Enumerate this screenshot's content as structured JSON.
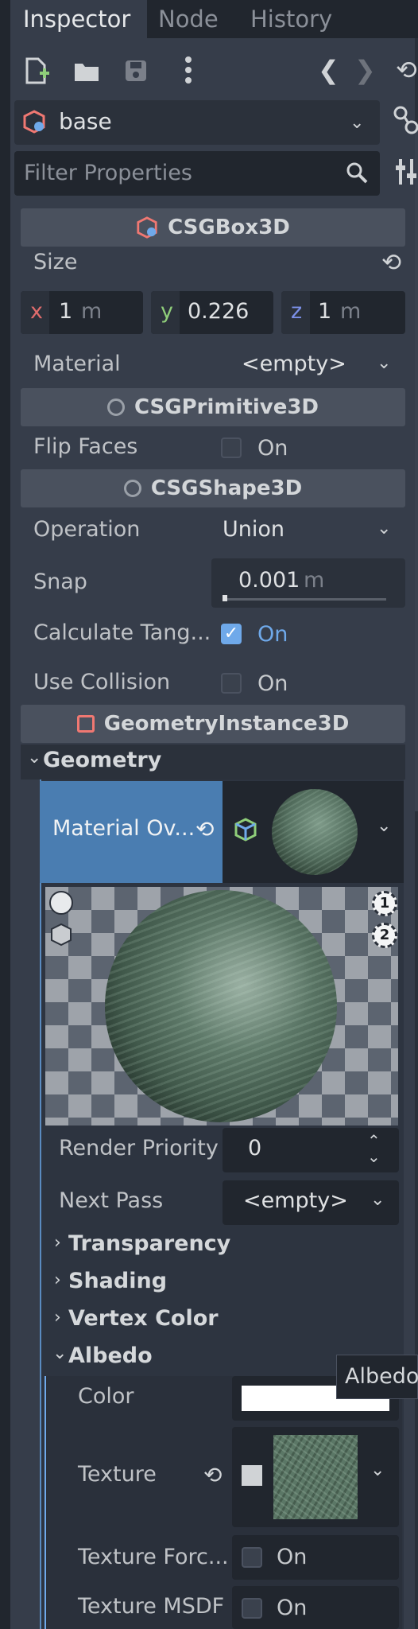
{
  "tabs": [
    {
      "label": "Inspector",
      "active": true
    },
    {
      "label": "Node",
      "active": false
    },
    {
      "label": "History",
      "active": false
    }
  ],
  "toolbar": {
    "icons": [
      "new-resource-icon",
      "open-folder-icon",
      "save-icon",
      "more-vert-icon",
      "back-arrow-icon",
      "forward-arrow-icon",
      "history-icon"
    ]
  },
  "object_selector": {
    "name": "base"
  },
  "filter": {
    "placeholder": "Filter Properties"
  },
  "sections": {
    "csgbox": "CSGBox3D",
    "csgprimitive": "CSGPrimitive3D",
    "csgshape": "CSGShape3D",
    "geometry_instance": "GeometryInstance3D"
  },
  "size": {
    "label": "Size",
    "x_axis": "x",
    "x_value": "1",
    "x_unit": "m",
    "y_axis": "y",
    "y_value": "0.226",
    "z_axis": "z",
    "z_value": "1",
    "z_unit": "m"
  },
  "material": {
    "label": "Material",
    "value": "<empty>"
  },
  "flip_faces": {
    "label": "Flip Faces",
    "value": "On",
    "checked": false
  },
  "operation": {
    "label": "Operation",
    "value": "Union"
  },
  "snap": {
    "label": "Snap",
    "value": "0.001",
    "unit": "m"
  },
  "calculate_tangents": {
    "label": "Calculate Tang...",
    "value": "On",
    "checked": true
  },
  "use_collision": {
    "label": "Use Collision",
    "value": "On",
    "checked": false
  },
  "geometry": {
    "label": "Geometry"
  },
  "material_override": {
    "label": "Material Ov..."
  },
  "preview_markers": {
    "light1": "1",
    "light2": "2"
  },
  "render_priority": {
    "label": "Render Priority",
    "value": "0"
  },
  "next_pass": {
    "label": "Next Pass",
    "value": "<empty>"
  },
  "groups": {
    "transparency": "Transparency",
    "shading": "Shading",
    "vertex_color": "Vertex Color",
    "albedo": "Albedo"
  },
  "albedo": {
    "color_label": "Color",
    "color_value": "#ffffff",
    "texture_label": "Texture",
    "texture_force_label": "Texture Forc...",
    "texture_force_value": "On",
    "texture_msdf_label": "Texture MSDF",
    "texture_msdf_value": "On"
  },
  "tooltip": {
    "text": "Albedo"
  },
  "colors": {
    "accent": "#6fa9ea",
    "panel": "#363d4a",
    "field": "#21262e",
    "section_header": "#4a515e",
    "x_axis": "#e06c6c",
    "y_axis": "#8fce7a",
    "z_axis": "#7b8fe6"
  }
}
